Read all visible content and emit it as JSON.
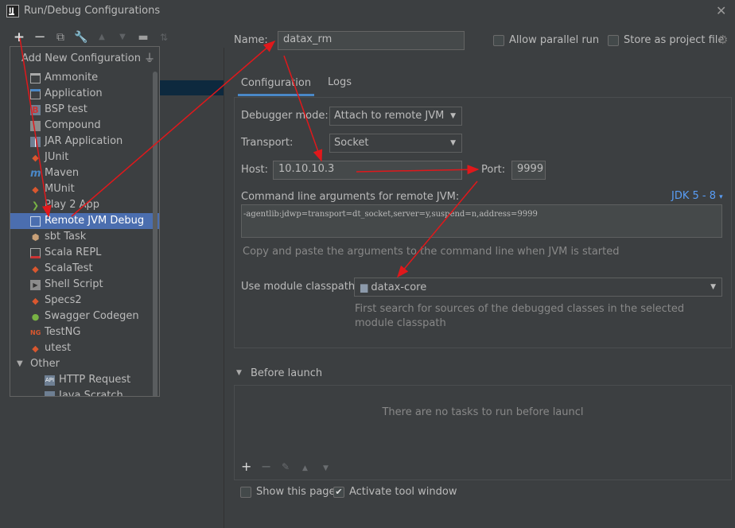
{
  "window": {
    "title": "Run/Debug Configurations"
  },
  "popup": {
    "title": "Add New Configuration",
    "items": [
      {
        "label": "Ammonite",
        "icon": "ammonite-icon"
      },
      {
        "label": "Application",
        "icon": "application-icon"
      },
      {
        "label": "BSP test",
        "icon": "bsp-test-icon"
      },
      {
        "label": "Compound",
        "icon": "compound-icon"
      },
      {
        "label": "JAR Application",
        "icon": "jar-application-icon"
      },
      {
        "label": "JUnit",
        "icon": "junit-icon"
      },
      {
        "label": "Maven",
        "icon": "maven-icon"
      },
      {
        "label": "MUnit",
        "icon": "munit-icon"
      },
      {
        "label": "Play 2 App",
        "icon": "play2-icon"
      },
      {
        "label": "Remote JVM Debug",
        "icon": "remote-jvm-debug-icon"
      },
      {
        "label": "sbt Task",
        "icon": "sbt-icon"
      },
      {
        "label": "Scala REPL",
        "icon": "scala-repl-icon"
      },
      {
        "label": "ScalaTest",
        "icon": "scalatest-icon"
      },
      {
        "label": "Shell Script",
        "icon": "shell-script-icon"
      },
      {
        "label": "Specs2",
        "icon": "specs2-icon"
      },
      {
        "label": "Swagger Codegen",
        "icon": "swagger-icon"
      },
      {
        "label": "TestNG",
        "icon": "testng-icon"
      },
      {
        "label": "utest",
        "icon": "utest-icon"
      }
    ],
    "group": {
      "label": "Other"
    },
    "children": [
      {
        "label": "HTTP Request",
        "icon": "http-request-icon"
      },
      {
        "label": "Java Scratch",
        "icon": "java-scratch-icon"
      }
    ]
  },
  "form": {
    "name_label": "Name:",
    "name_value": "datax_rm",
    "allow_parallel_label": "Allow parallel run",
    "store_project_label": "Store as project file",
    "tabs": [
      "Configuration",
      "Logs"
    ],
    "debugger_mode_label": "Debugger mode:",
    "debugger_mode_value": "Attach to remote JVM",
    "transport_label": "Transport:",
    "transport_value": "Socket",
    "host_label": "Host:",
    "host_value": "10.10.10.3",
    "port_label": "Port:",
    "port_value": "9999",
    "cmdline_label": "Command line arguments for remote JVM:",
    "jdk_link": "JDK 5 - 8",
    "cmdline_value": "-agentlib:jdwp=transport=dt_socket,server=y,suspend=n,address=9999",
    "cmdline_hint": "Copy and paste the arguments to the command line when JVM is started",
    "module_label": "Use module classpath:",
    "module_value": "datax-core",
    "module_hint_1": "First search for sources of the debugged classes in the selected",
    "module_hint_2": "module classpath",
    "before_launch_label": "Before launch",
    "no_tasks_text": "There are no tasks to run before launcl",
    "show_page_label": "Show this page",
    "activate_tool_label": "Activate tool window"
  },
  "colors": {
    "background": "#3c3f41",
    "selection": "#4b6eaf",
    "tab_underline": "#4a88c7",
    "link": "#589df6",
    "annotation_arrow": "#e0181b"
  }
}
